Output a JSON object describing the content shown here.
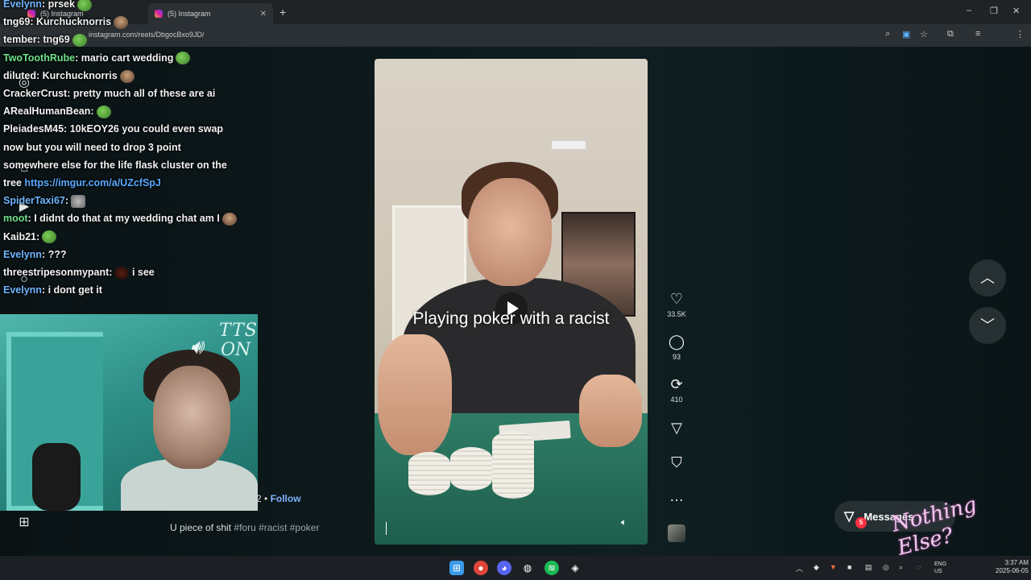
{
  "browser": {
    "tabs": [
      {
        "label": "(5) Instagram"
      },
      {
        "label": "(5) Instagram"
      }
    ],
    "url": "instagram.com/reels/DbgocBxo9JD/"
  },
  "chat": {
    "messages": [
      {
        "user": "Evelynn",
        "text": "prsek",
        "user_color": "blue",
        "emote": "frog"
      },
      {
        "user": "tng69",
        "text": "Kurchucknorris",
        "user_color": "white",
        "emote": "face"
      },
      {
        "user": "tember",
        "text": "tng69",
        "user_color": "white",
        "emote": "frog"
      },
      {
        "user": "TwoToothRube",
        "text": "mario cart wedding",
        "user_color": "green",
        "emote": "frog"
      },
      {
        "user": "diluted",
        "text": "Kurchucknorris",
        "user_color": "white",
        "emote": "face"
      },
      {
        "user": "CrackerCrust",
        "text": "pretty much all of these are ai",
        "user_color": "white"
      },
      {
        "user": "ARealHumanBean",
        "text": "",
        "user_color": "white",
        "emote": "frog"
      },
      {
        "user": "PleiadesM45",
        "text": "10kEOY26 you could even swap now but you will need to drop 3 point somewhere else for the life flask cluster on the tree",
        "user_color": "white",
        "link": "https://imgur.com/a/UZcfSpJ"
      },
      {
        "user": "SpiderTaxi67",
        "text": "",
        "user_color": "blue",
        "emote": "gray"
      },
      {
        "user": "moot",
        "text": "I didnt do that at my wedding chat am I",
        "user_color": "green",
        "emote": "face"
      },
      {
        "user": "Kaib21",
        "text": "",
        "user_color": "white",
        "emote": "frog"
      },
      {
        "user": "Evelynn",
        "text": "???",
        "user_color": "blue"
      },
      {
        "user": "threestripesonmypant",
        "text": "i see",
        "user_color": "white",
        "emote": "dark"
      },
      {
        "user": "Evelynn",
        "text": "i dont get it",
        "user_color": "blue"
      }
    ]
  },
  "overlay": {
    "tts_line1": "TTS",
    "tts_line2": "ON",
    "nothing_else": "Nothing Else?"
  },
  "video": {
    "caption": "Playing poker with a racist",
    "description": "U piece of shit",
    "hashtags": "#foru #racist #poker",
    "follow_prefix": "2 •",
    "follow_label": "Follow"
  },
  "actions": {
    "likes": "33.5K",
    "comments": "93",
    "reposts": "410"
  },
  "messages": {
    "label": "Messages",
    "badge": "5"
  },
  "taskbar": {
    "lang_line1": "ENG",
    "lang_line2": "US",
    "time": "3:37 AM",
    "date": "2025-06-05"
  },
  "colors": {
    "username_green": "#6fe28a",
    "username_blue": "#6fb6ff",
    "link": "#5aa9ff",
    "badge_red": "#ff3040",
    "overlay_pink": "#f0c9ee"
  },
  "icons": {
    "like": "heart-icon",
    "comment": "comment-icon",
    "repost": "repost-icon",
    "share": "send-icon",
    "save": "bookmark-icon",
    "more": "more-icon"
  }
}
